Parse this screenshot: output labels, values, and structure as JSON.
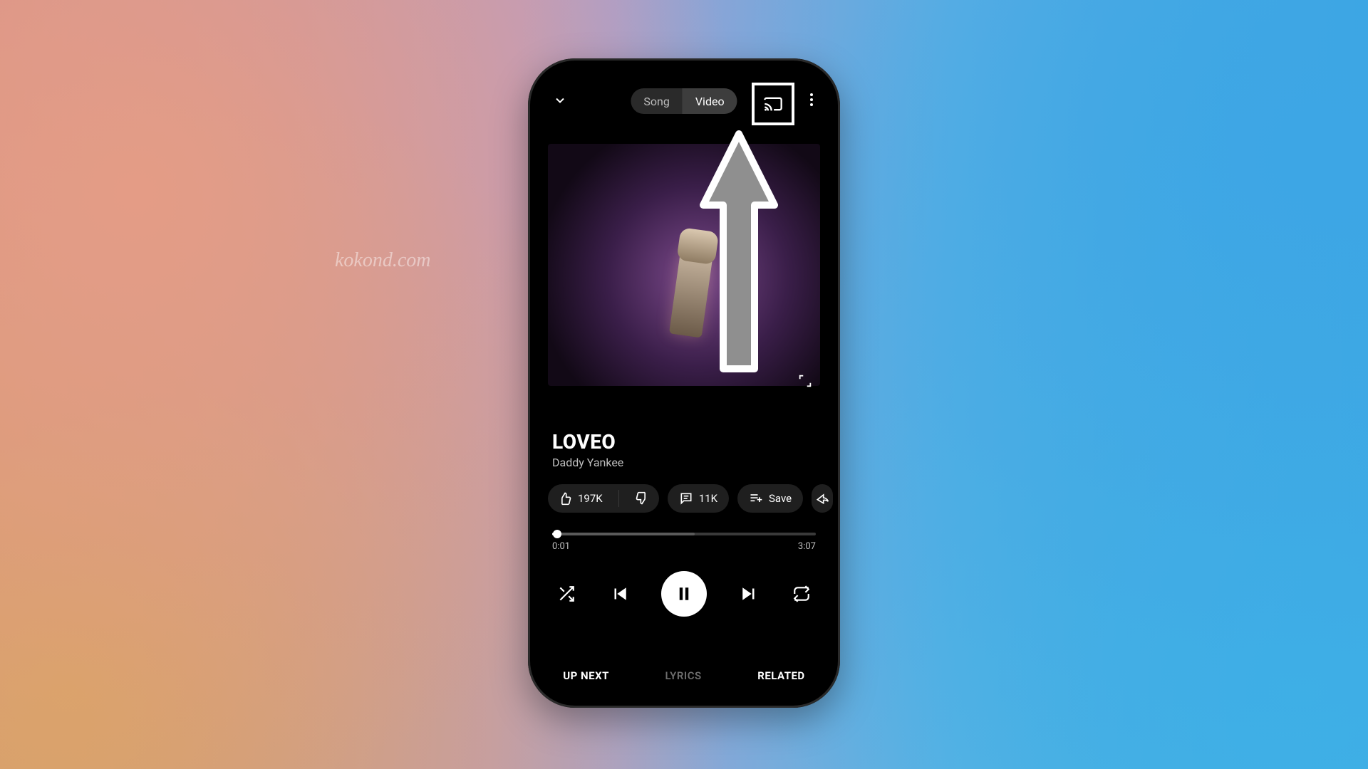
{
  "watermark": "kokond.com",
  "topbar": {
    "song_label": "Song",
    "video_label": "Video",
    "active_segment": "Video"
  },
  "now_playing": {
    "title": "LOVEO",
    "artist": "Daddy Yankee"
  },
  "actions": {
    "like_count": "197K",
    "comment_count": "11K",
    "save_label": "Save"
  },
  "progress": {
    "elapsed": "0:01",
    "duration": "3:07",
    "played_pct": 2,
    "buffer_pct": 54
  },
  "tabs": {
    "up_next": "UP NEXT",
    "lyrics": "LYRICS",
    "related": "RELATED"
  },
  "icons": {
    "collapse": "chevron-down-icon",
    "cast": "cast-icon",
    "more": "more-vert-icon",
    "expand": "expand-icon",
    "like": "thumb-up-icon",
    "dislike": "thumb-down-icon",
    "comment": "comment-icon",
    "save": "playlist-add-icon",
    "share": "share-icon",
    "shuffle": "shuffle-icon",
    "prev": "skip-previous-icon",
    "pause": "pause-icon",
    "next": "skip-next-icon",
    "repeat": "repeat-icon"
  },
  "colors": {
    "chip_bg": "#1f1f1f",
    "text_secondary": "#bfbfbf"
  }
}
